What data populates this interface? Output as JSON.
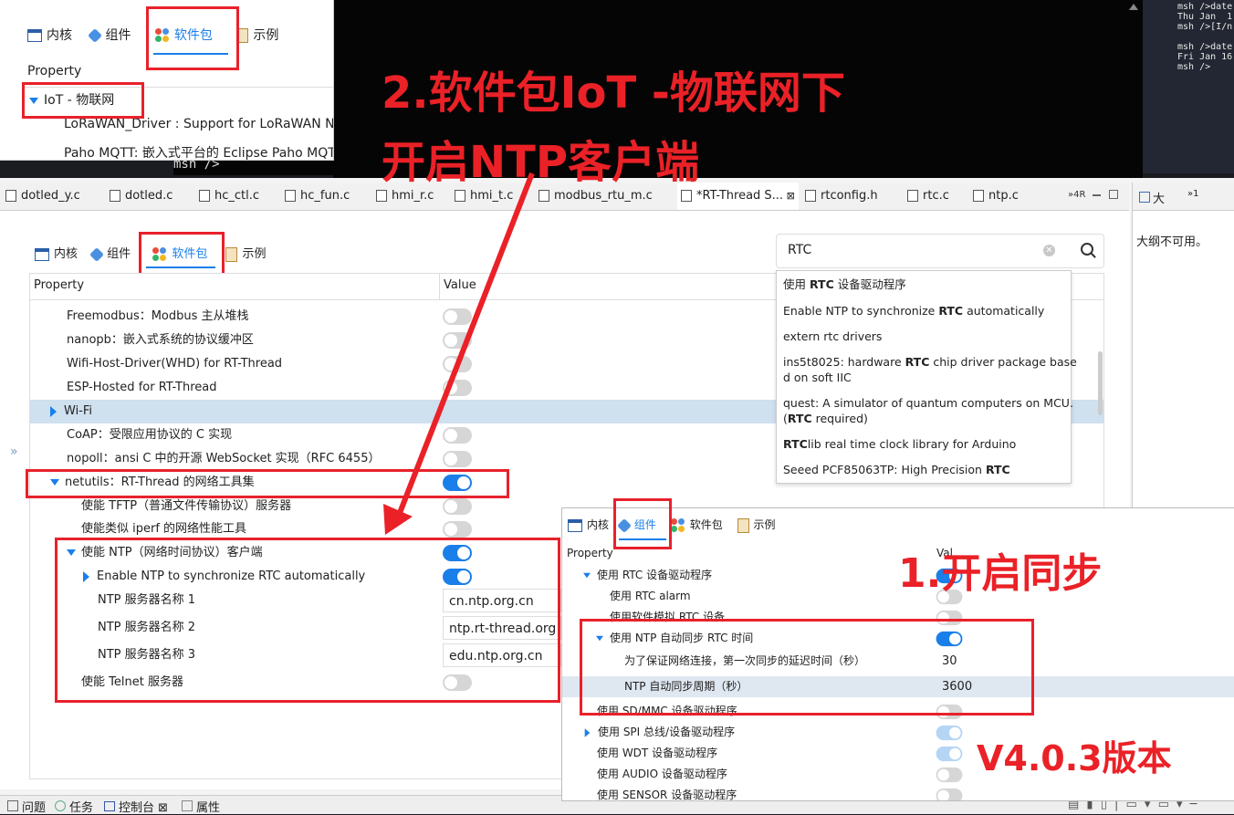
{
  "nav_tabs": {
    "kernel": "内核",
    "components": "组件",
    "packages": "软件包",
    "examples": "示例"
  },
  "top_panel": {
    "header_property": "Property",
    "iot_label": "IoT - 物联网",
    "items": [
      "LoRaWAN_Driver : Support for LoRaWAN Ne",
      "Paho MQTT: 嵌入式平台的 Eclipse Paho MQT"
    ]
  },
  "terminal_lines": [
    "msh />date",
    "Thu Jan  1",
    "msh />[I/n",
    "",
    "msh />date",
    "Fri Jan 16",
    "msh />"
  ],
  "editor_tabs": [
    "dotled_y.c",
    "dotled.c",
    "hc_ctl.c",
    "hc_fun.c",
    "hmi_r.c",
    "hmi_t.c",
    "modbus_rtu_m.c",
    "*RT-Thread S...",
    "rtconfig.h",
    "rtc.c",
    "ntp.c"
  ],
  "editor_tab_overflow": "»4R",
  "outline": {
    "title": "大",
    "overflow": "»1",
    "message": "大纲不可用。"
  },
  "console_text": "msh  />",
  "search": {
    "value": "RTC",
    "results": [
      {
        "pre": "使用 ",
        "bold": "RTC",
        "post": " 设备驱动程序"
      },
      {
        "pre": "Enable NTP to synchronize ",
        "bold": "RTC",
        "post": " automatically"
      },
      {
        "pre": "extern rtc drivers",
        "bold": "",
        "post": ""
      },
      {
        "pre": "ins5t8025: hardware ",
        "bold": "RTC",
        "post": " chip driver package base",
        "line2": "d on soft IIC"
      },
      {
        "pre": "quest: A simulator of quantum computers on MCU.",
        "bold": "",
        "post": "",
        "line2pre": "(",
        "line2bold": "RTC",
        "line2post": " required)"
      },
      {
        "pre": "",
        "bold": "RTC",
        "post": "lib real time clock library for Arduino"
      },
      {
        "pre": "Seeed PCF85063TP: High Precision ",
        "bold": "RTC",
        "post": ""
      }
    ]
  },
  "main_table": {
    "col_property": "Property",
    "col_value": "Value",
    "rows": [
      {
        "label": "Freemodbus：Modbus 主从堆栈",
        "state": "off"
      },
      {
        "label": "nanopb：嵌入式系统的协议缓冲区",
        "state": "off"
      },
      {
        "label": "Wifi-Host-Driver(WHD) for RT-Thread",
        "state": "off"
      },
      {
        "label": "ESP-Hosted for RT-Thread",
        "state": "off"
      },
      {
        "label": "Wi-Fi",
        "state": "group"
      },
      {
        "label": "CoAP：受限应用协议的 C 实现",
        "state": "off"
      },
      {
        "label": "nopoll：ansi C 中的开源 WebSocket 实现（RFC 6455）",
        "state": "off"
      },
      {
        "label": "netutils：RT-Thread 的网络工具集",
        "state": "on"
      },
      {
        "label": "使能 TFTP（普通文件传输协议）服务器",
        "state": "off"
      },
      {
        "label": "使能类似 iperf 的网络性能工具",
        "state": "off"
      },
      {
        "label": "使能 NTP（网络时间协议）客户端",
        "state": "on"
      },
      {
        "label": "Enable NTP to synchronize RTC automatically",
        "state": "on"
      },
      {
        "label": "NTP 服务器名称 1",
        "value": "cn.ntp.org.cn"
      },
      {
        "label": "NTP 服务器名称 2",
        "value": "ntp.rt-thread.org"
      },
      {
        "label": "NTP 服务器名称 3",
        "value": "edu.ntp.org.cn"
      },
      {
        "label": "使能 Telnet 服务器",
        "state": "off"
      }
    ]
  },
  "inset_table": {
    "col_property": "Property",
    "col_value": "Val",
    "rows": [
      {
        "label": "使用 RTC 设备驱动程序",
        "state": "on"
      },
      {
        "label": "使用 RTC alarm",
        "state": "off"
      },
      {
        "label": "使用软件模拟 RTC 设备",
        "state": "off"
      },
      {
        "label": "使用 NTP 自动同步 RTC 时间",
        "state": "on"
      },
      {
        "label": "为了保证网络连接，第一次同步的延迟时间（秒）",
        "value": "30"
      },
      {
        "label": "NTP 自动同步周期（秒）",
        "value": "3600"
      },
      {
        "label": "使用 SD/MMC 设备驱动程序",
        "state": "off"
      },
      {
        "label": "使用 SPI 总线/设备驱动程序",
        "state": "light"
      },
      {
        "label": "使用 WDT 设备驱动程序",
        "state": "light"
      },
      {
        "label": "使用 AUDIO 设备驱动程序",
        "state": "off"
      },
      {
        "label": "使用 SENSOR 设备驱动程序",
        "state": "off"
      }
    ]
  },
  "bottom_tabs": [
    "问题",
    "任务",
    "控制台",
    "属性"
  ],
  "annotations": {
    "step2_line1": "2.软件包IoT -物联网下",
    "step2_line2": "开启NTP客户端",
    "step1": "1.开启同步",
    "version": "V4.0.3版本"
  },
  "colors": {
    "accent": "#1a7fe8",
    "annotation_red": "#ea2127",
    "selection": "#cfe0ef"
  }
}
